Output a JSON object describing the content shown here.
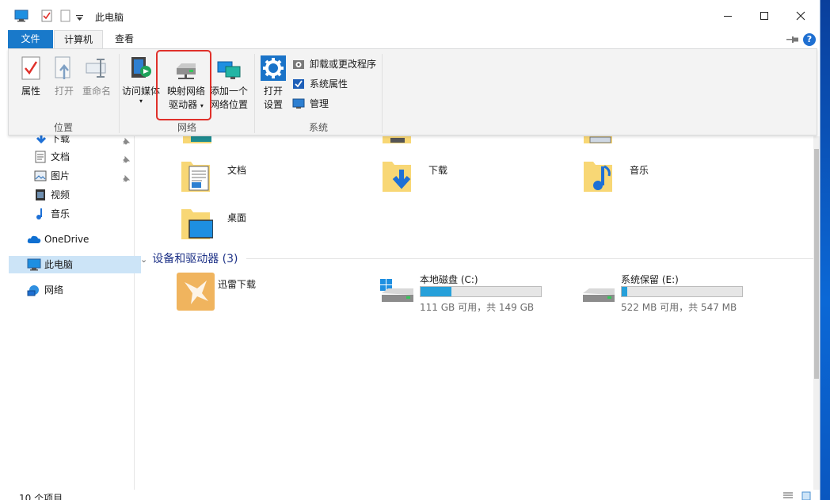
{
  "window": {
    "title": "此电脑"
  },
  "tabs": {
    "file": "文件",
    "computer": "计算机",
    "view": "查看"
  },
  "ribbon": {
    "location": {
      "label": "位置",
      "properties": "属性",
      "open": "打开",
      "rename": "重命名"
    },
    "network": {
      "label": "网络",
      "access_media": "访问媒体",
      "map_drive_line1": "映射网络",
      "map_drive_line2": "驱动器",
      "add_location_line1": "添加一个",
      "add_location_line2": "网络位置"
    },
    "system": {
      "label": "系统",
      "open_settings_line1": "打开",
      "open_settings_line2": "设置",
      "uninstall": "卸载或更改程序",
      "system_properties": "系统属性",
      "manage": "管理"
    }
  },
  "nav": {
    "items": [
      {
        "label": "下载",
        "icon": "download-arrow-icon"
      },
      {
        "label": "文档",
        "icon": "document-icon"
      },
      {
        "label": "图片",
        "icon": "picture-icon"
      },
      {
        "label": "视频",
        "icon": "video-icon"
      },
      {
        "label": "音乐",
        "icon": "music-note-icon"
      },
      {
        "label": "OneDrive",
        "icon": "cloud-icon"
      },
      {
        "label": "此电脑",
        "icon": "monitor-icon"
      },
      {
        "label": "网络",
        "icon": "network-icon"
      }
    ]
  },
  "content": {
    "folders": [
      {
        "label": "文档"
      },
      {
        "label": "下载"
      },
      {
        "label": "音乐"
      },
      {
        "label": "桌面"
      }
    ],
    "devices_header": "设备和驱动器 (3)",
    "xunlei": "迅雷下载",
    "drives": [
      {
        "name": "本地磁盘 (C:)",
        "detail": "111 GB 可用，共 149 GB",
        "used_fraction": 0.255
      },
      {
        "name": "系统保留 (E:)",
        "detail": "522 MB 可用，共 547 MB",
        "used_fraction": 0.046
      }
    ]
  },
  "status": {
    "count": "10 个项目"
  },
  "colors": {
    "accent": "#1979ca",
    "highlight_box": "#e0302a",
    "drive_fill": "#26a0da",
    "folder": "#f8d775"
  }
}
